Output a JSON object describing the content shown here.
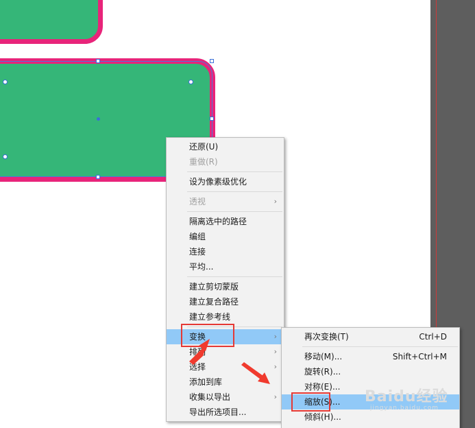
{
  "context_menu": {
    "items": [
      {
        "label": "还原(U)",
        "enabled": true
      },
      {
        "label": "重做(R)",
        "enabled": false
      },
      {
        "label": "设为像素级优化",
        "enabled": true
      },
      {
        "label": "透视",
        "enabled": false,
        "submenu": true
      },
      {
        "label": "隔离选中的路径",
        "enabled": true
      },
      {
        "label": "编组",
        "enabled": true
      },
      {
        "label": "连接",
        "enabled": true
      },
      {
        "label": "平均...",
        "enabled": true
      },
      {
        "label": "建立剪切蒙版",
        "enabled": true
      },
      {
        "label": "建立复合路径",
        "enabled": true
      },
      {
        "label": "建立参考线",
        "enabled": true
      },
      {
        "label": "变换",
        "enabled": true,
        "submenu": true,
        "highlighted": true
      },
      {
        "label": "排列",
        "enabled": true,
        "submenu": true
      },
      {
        "label": "选择",
        "enabled": true,
        "submenu": true
      },
      {
        "label": "添加到库",
        "enabled": true
      },
      {
        "label": "收集以导出",
        "enabled": true,
        "submenu": true
      },
      {
        "label": "导出所选项目...",
        "enabled": true
      }
    ]
  },
  "transform_submenu": {
    "items": [
      {
        "label": "再次变换(T)",
        "shortcut": "Ctrl+D"
      },
      {
        "label": "移动(M)...",
        "shortcut": "Shift+Ctrl+M"
      },
      {
        "label": "旋转(R)...",
        "shortcut": ""
      },
      {
        "label": "对称(E)...",
        "shortcut": ""
      },
      {
        "label": "缩放(S)...",
        "shortcut": "",
        "highlighted": true
      },
      {
        "label": "倾斜(H)...",
        "shortcut": ""
      }
    ]
  },
  "watermark": {
    "brand": "Baidu",
    "brand_cn": "经验",
    "url": "jingyan.baidu.com"
  },
  "colors": {
    "shape_fill": "#35b678",
    "shape_stroke": "#e8247a",
    "selection": "#3a6fd8",
    "menu_highlight": "#91c9f7",
    "annotation_red": "#e53935"
  },
  "icons": {
    "submenu_arrow": "chevron-right-icon"
  }
}
